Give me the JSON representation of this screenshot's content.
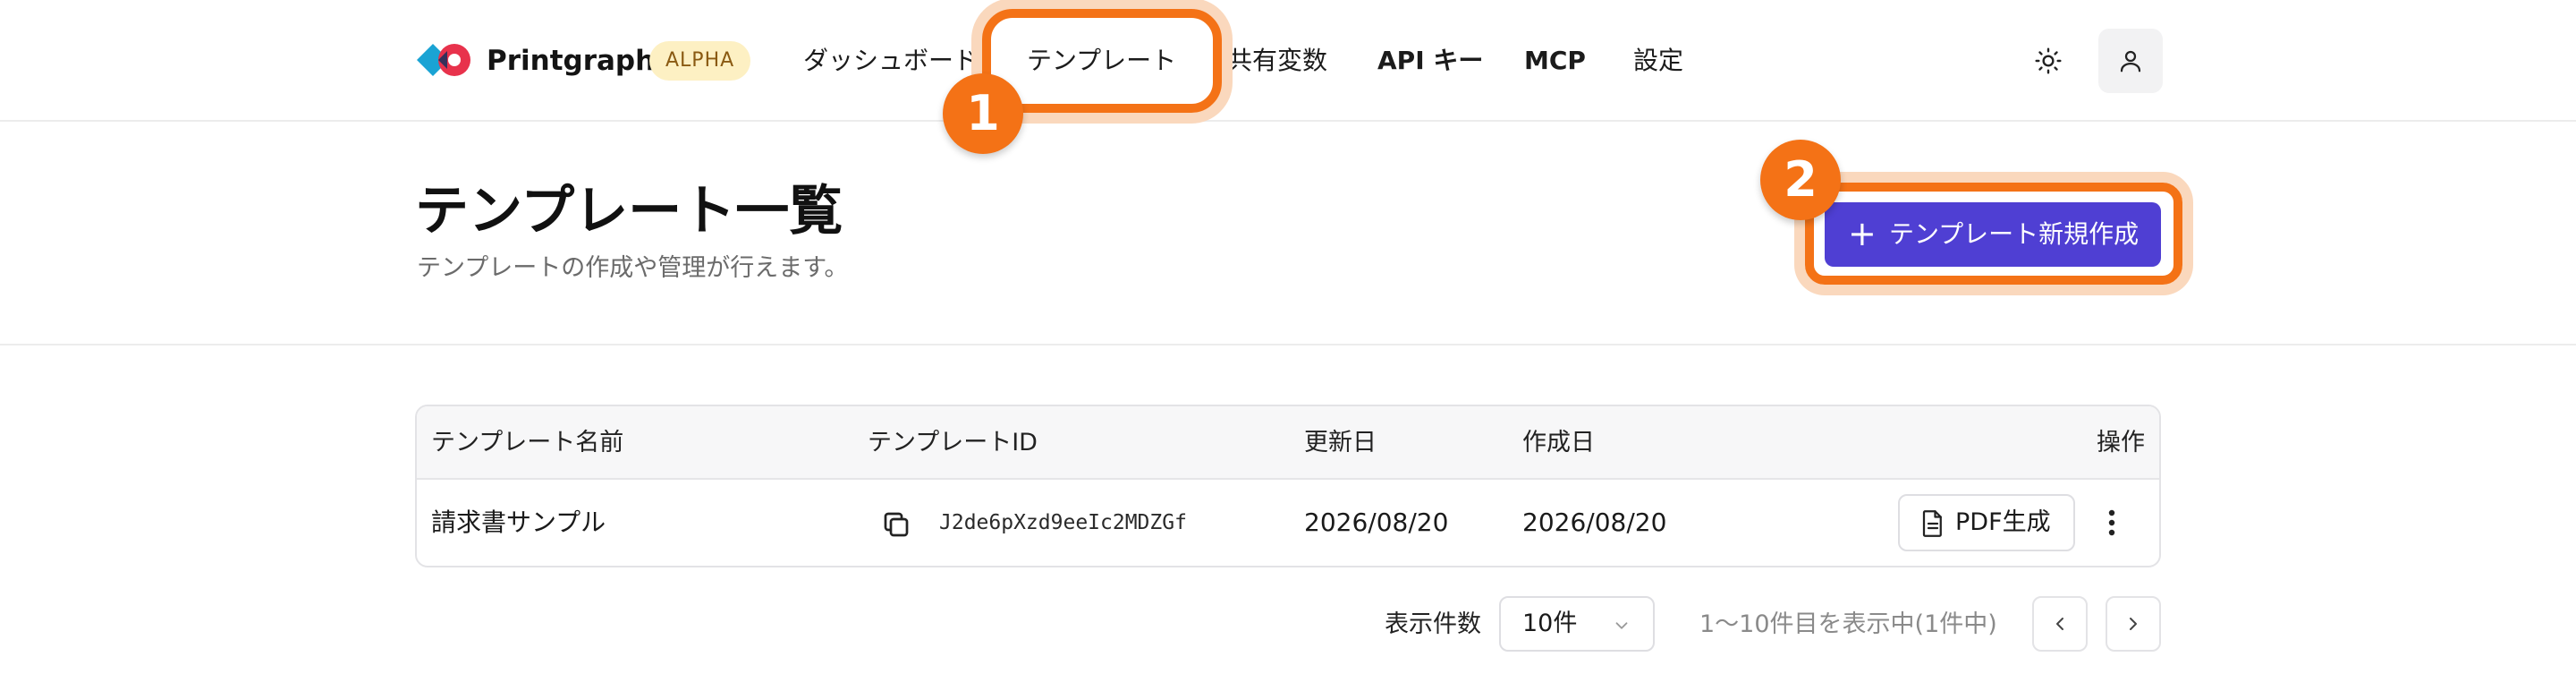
{
  "header": {
    "brand": "Printgraph",
    "badge": "ALPHA",
    "nav": [
      {
        "label": "ダッシュボード"
      },
      {
        "label": "テンプレート"
      },
      {
        "label": "共有変数"
      },
      {
        "label": "API キー"
      },
      {
        "label": "MCP"
      },
      {
        "label": "設定"
      }
    ],
    "icons": {
      "theme": "sun-icon",
      "user": "user-icon"
    }
  },
  "page": {
    "title": "テンプレート一覧",
    "subtitle": "テンプレートの作成や管理が行えます。",
    "new_button": "テンプレート新規作成"
  },
  "table": {
    "columns": [
      "テンプレート名前",
      "テンプレートID",
      "更新日",
      "作成日",
      "操作"
    ],
    "rows": [
      {
        "name": "請求書サンプル",
        "id": "J2de6pXzd9eeIc2MDZGf",
        "updated": "2026/08/20",
        "created": "2026/08/20",
        "action": "PDF生成"
      }
    ]
  },
  "pagination": {
    "per_page_label": "表示件数",
    "per_page_value": "10件",
    "range_text": "1〜10件目を表示中(1件中)"
  },
  "callouts": [
    "1",
    "2"
  ],
  "colors": {
    "accent": "#4f3fd3",
    "callout": "#f47216",
    "alpha_bg": "#fdf0c3"
  }
}
